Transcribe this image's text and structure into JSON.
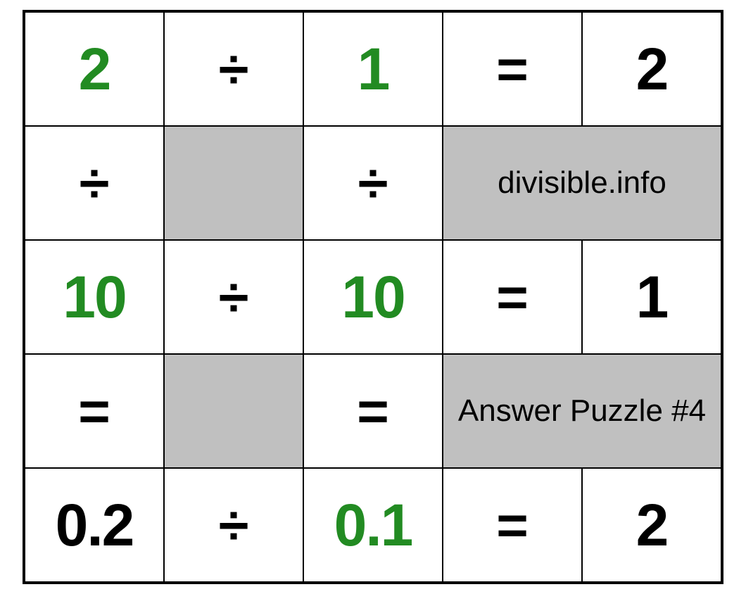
{
  "grid": {
    "r1c1": "2",
    "r1c2": "÷",
    "r1c3": "1",
    "r1c4": "=",
    "r1c5": "2",
    "r2c1": "÷",
    "r2c3": "÷",
    "r2merged": "divisible.info",
    "r3c1": "10",
    "r3c2": "÷",
    "r3c3": "10",
    "r3c4": "=",
    "r3c5": "1",
    "r4c1": "=",
    "r4c3": "=",
    "r4merged": "Answer Puzzle #4",
    "r5c1": "0.2",
    "r5c2": "÷",
    "r5c3": "0.1",
    "r5c4": "=",
    "r5c5": "2"
  }
}
